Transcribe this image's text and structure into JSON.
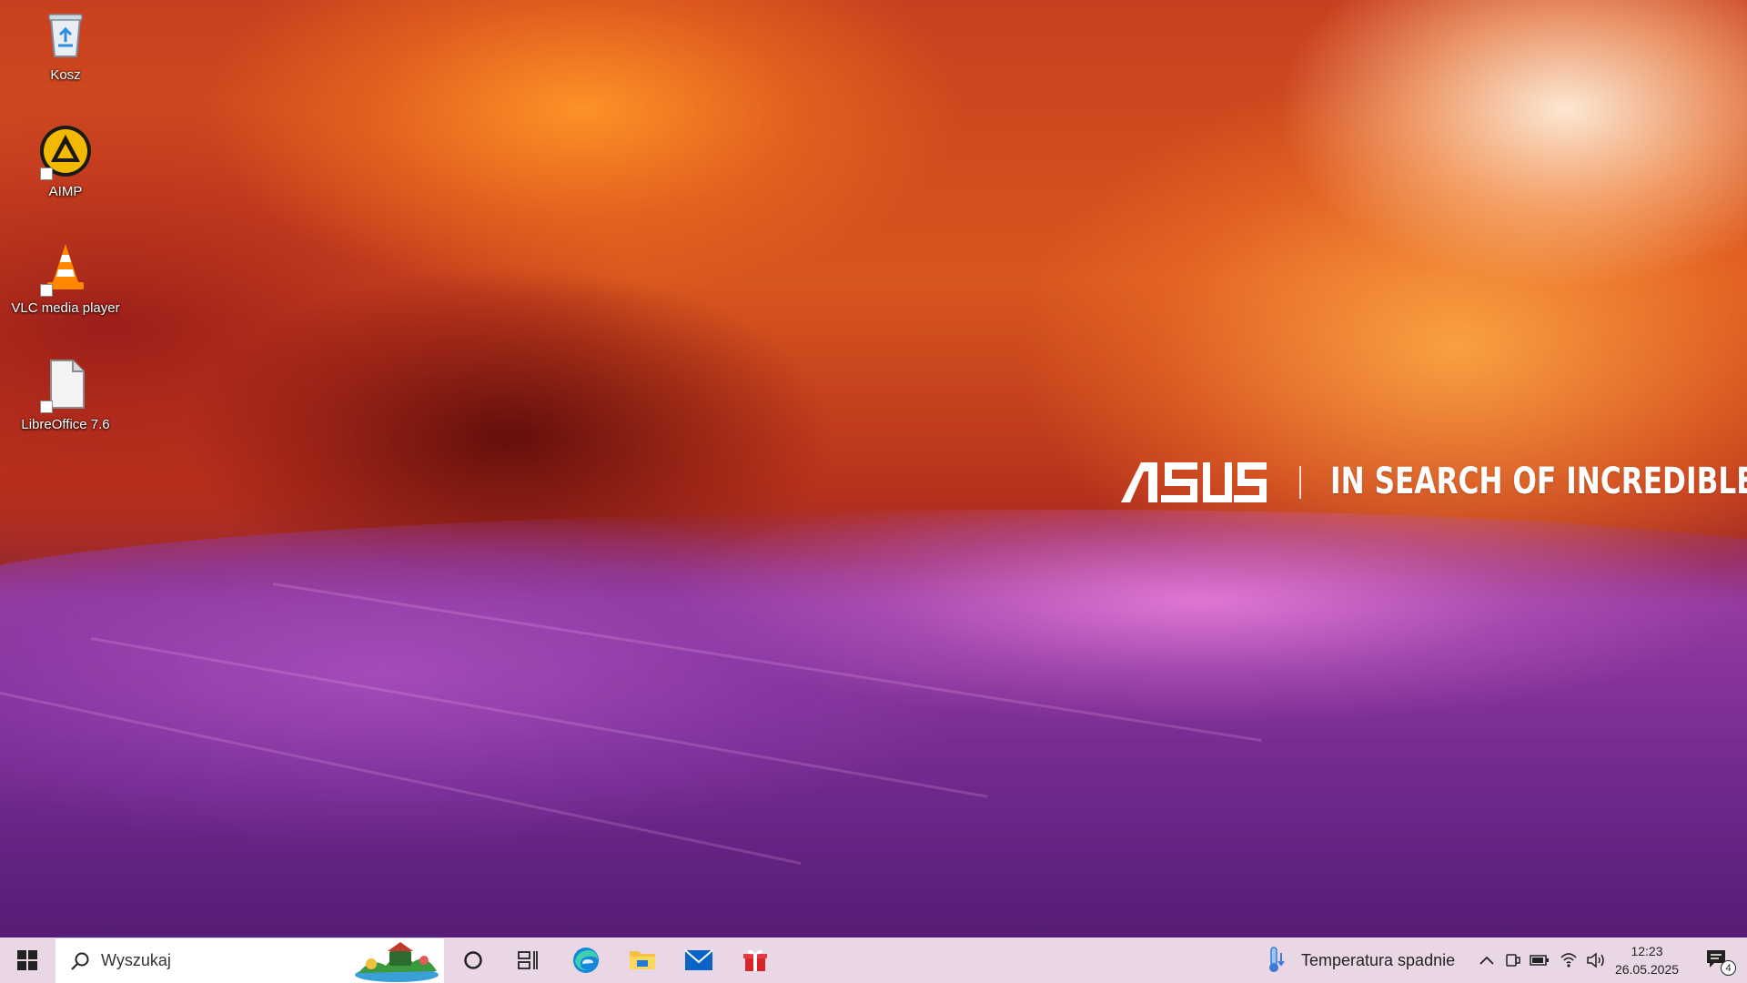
{
  "desktop": {
    "icons": [
      {
        "label": "Kosz"
      },
      {
        "label": "AIMP"
      },
      {
        "label": "VLC media player"
      },
      {
        "label": "LibreOffice 7.6"
      }
    ]
  },
  "wallpaper": {
    "brand_logo_text": "ASUS",
    "tagline": "IN SEARCH OF INCREDIBLE"
  },
  "taskbar": {
    "search_placeholder": "Wyszukaj",
    "pinned_apps": [
      {
        "icon": "edge-icon"
      },
      {
        "icon": "file-explorer-icon"
      },
      {
        "icon": "mail-icon"
      },
      {
        "icon": "gift-icon"
      }
    ],
    "weather_text": "Temperatura spadnie",
    "clock": {
      "time": "12:23",
      "date": "26.05.2025"
    },
    "notifications_count": "4",
    "colors": {
      "taskbar_bg": "#ead7e6",
      "accent_blue": "#0a64c8"
    }
  }
}
